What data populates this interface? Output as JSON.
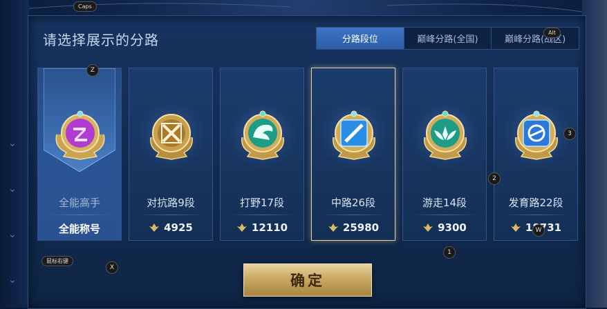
{
  "dialog": {
    "title": "请选择展示的分路",
    "tabs": [
      {
        "label": "分路段位",
        "active": true
      },
      {
        "label": "巅峰分路(全国)",
        "active": false
      },
      {
        "label": "巅峰分路(战区)",
        "active": false
      }
    ],
    "confirm_label": "确定"
  },
  "cards": [
    {
      "name": "全能高手",
      "label": "全能称号",
      "emblem": "all-round-emblem-icon",
      "color": "#b23bd1"
    },
    {
      "name": "对抗路9段",
      "value": "4925",
      "emblem": "clash-lane-emblem-icon",
      "color": "#caa24a"
    },
    {
      "name": "打野17段",
      "value": "12110",
      "emblem": "jungle-emblem-icon",
      "color": "#1f9c86"
    },
    {
      "name": "中路26段",
      "value": "25980",
      "emblem": "mid-lane-emblem-icon",
      "color": "#2a8ee6",
      "selected": true
    },
    {
      "name": "游走14段",
      "value": "9300",
      "emblem": "roam-emblem-icon",
      "color": "#1f9c86"
    },
    {
      "name": "发育路22段",
      "value": "18731",
      "emblem": "farm-lane-emblem-icon",
      "color": "#2a78d8"
    }
  ],
  "key_hints": {
    "caps": "Caps",
    "alt": "Alt",
    "z": "Z",
    "x": "X",
    "one": "1",
    "two": "2",
    "three": "3",
    "w": "W",
    "label": "鼠标右键"
  }
}
